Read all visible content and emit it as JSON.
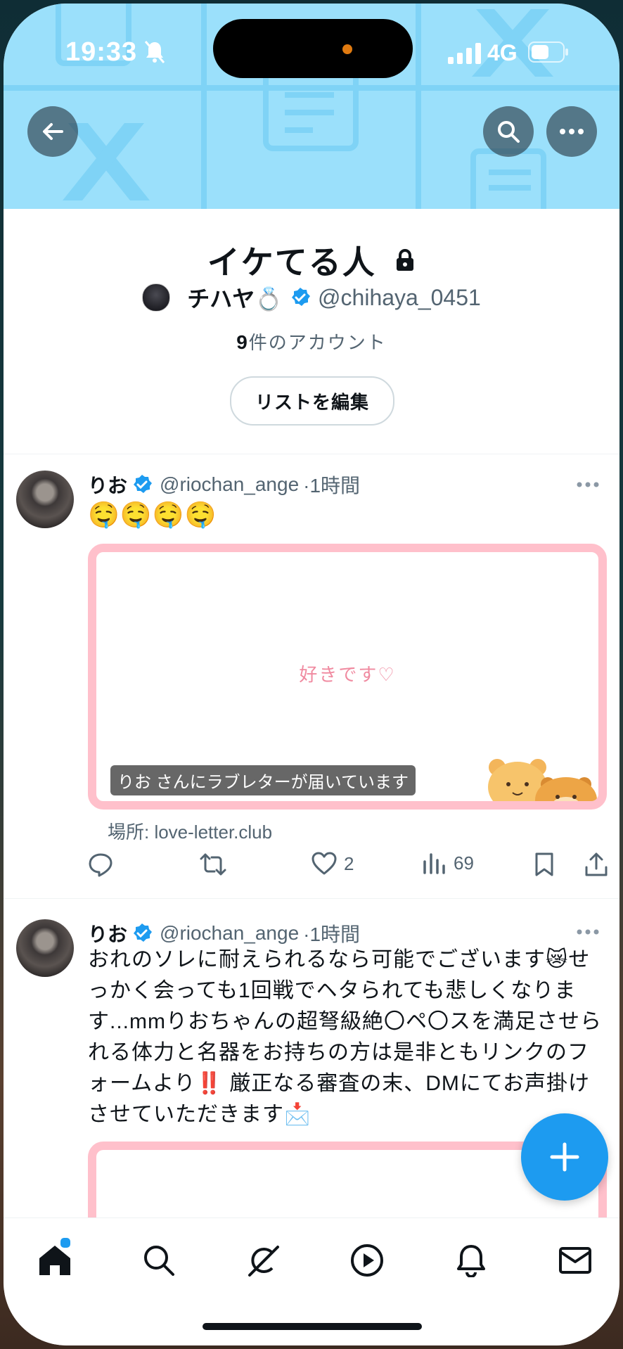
{
  "status_bar": {
    "time": "19:33",
    "network": "4G"
  },
  "header": {
    "back_icon": "arrow-left-icon",
    "search_icon": "search-icon",
    "more_icon": "more-horizontal-icon"
  },
  "list": {
    "title": "イケてる人",
    "owner_name": "チハヤ💍",
    "owner_handle": "@chihaya_0451",
    "member_count": "9",
    "member_suffix": "件のアカウント",
    "edit_button": "リストを編集"
  },
  "tweets": [
    {
      "name": "りお",
      "handle": "@riochan_ange",
      "time": "·1時間",
      "text": "🤤🤤🤤🤤",
      "card_title": "好きです♡",
      "card_caption": "りお さんにラブレターが届いています",
      "card_source": "場所: love-letter.club",
      "likes": "2",
      "views": "69"
    },
    {
      "name": "りお",
      "handle": "@riochan_ange",
      "time": "·1時間",
      "text": "おれのソレに耐えられるなら可能でございます😿せっかく会っても1回戦でヘタられても悲しくなります...mmりおちゃんの超弩級絶〇ペ〇スを満足させられる体力と名器をお持ちの方は是非ともリンクのフォームより‼️ 厳正なる審査の末、DMにてお声掛けさせていただきます📩"
    }
  ],
  "colors": {
    "accent": "#1d9bf0",
    "banner": "#9be0fb",
    "card_border": "#ffc0cb"
  },
  "nav": [
    "home-icon",
    "search-icon",
    "grok-icon",
    "play-icon",
    "bell-icon",
    "mail-icon"
  ]
}
